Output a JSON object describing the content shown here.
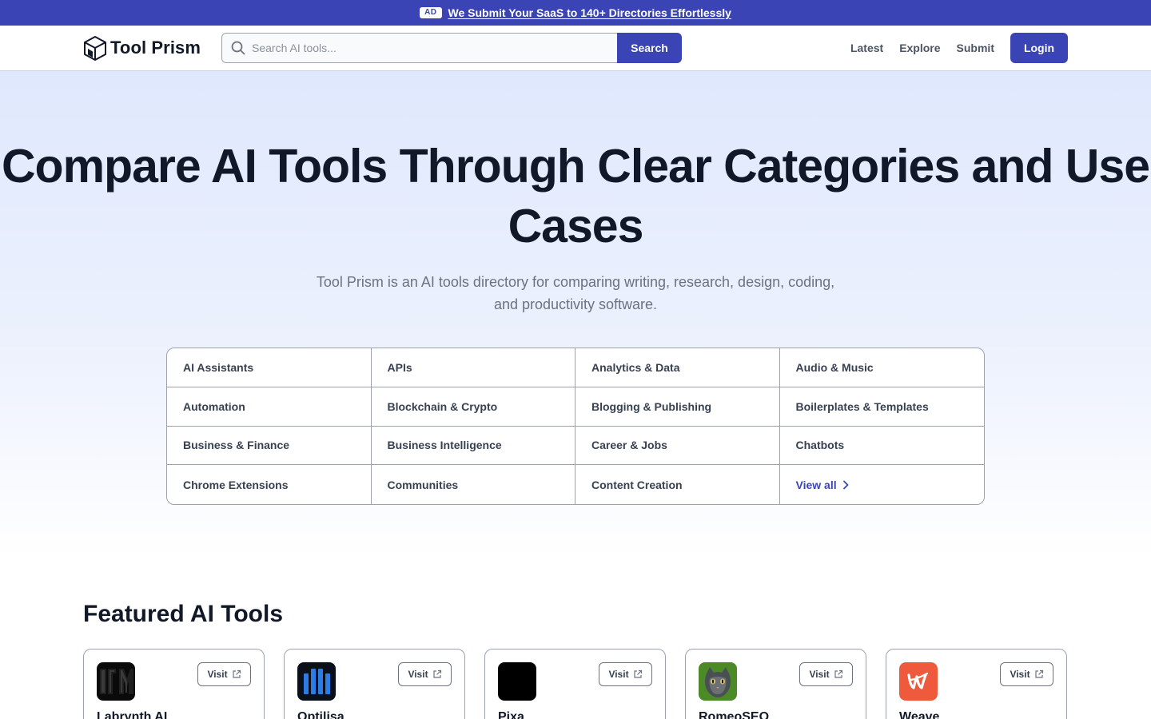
{
  "ad_banner": {
    "badge": "AD",
    "text": "We Submit Your SaaS to 140+ Directories Effortlessly"
  },
  "header": {
    "logo_text": "Tool Prism",
    "search_placeholder": "Search AI tools...",
    "search_button": "Search",
    "nav": [
      "Latest",
      "Explore",
      "Submit"
    ],
    "login": "Login"
  },
  "hero": {
    "title": "Compare AI Tools Through Clear Categories and Use Cases",
    "subtitle": "Tool Prism is an AI tools directory for comparing writing, research, design, coding, and productivity software."
  },
  "categories": [
    "AI Assistants",
    "APIs",
    "Analytics & Data",
    "Audio & Music",
    "Automation",
    "Blockchain & Crypto",
    "Blogging & Publishing",
    "Boilerplates & Templates",
    "Business & Finance",
    "Business Intelligence",
    "Career & Jobs",
    "Chatbots",
    "Chrome Extensions",
    "Communities",
    "Content Creation"
  ],
  "view_all": "View all",
  "featured": {
    "title": "Featured AI Tools",
    "visit_label": "Visit",
    "tools": [
      {
        "name": "Labrynth AI",
        "icon": "labrynth-logo"
      },
      {
        "name": "Optilisa",
        "icon": "optilisa-logo"
      },
      {
        "name": "Pixa",
        "icon": "pixa-logo"
      },
      {
        "name": "RomeoSEO",
        "icon": "romeoseo-logo"
      },
      {
        "name": "Weave",
        "icon": "weave-logo"
      }
    ]
  },
  "colors": {
    "brand": "#3a44b4",
    "hero_gradient_top": "#dfe8fd",
    "text_dark": "#111827",
    "text_muted": "#6b7280"
  }
}
